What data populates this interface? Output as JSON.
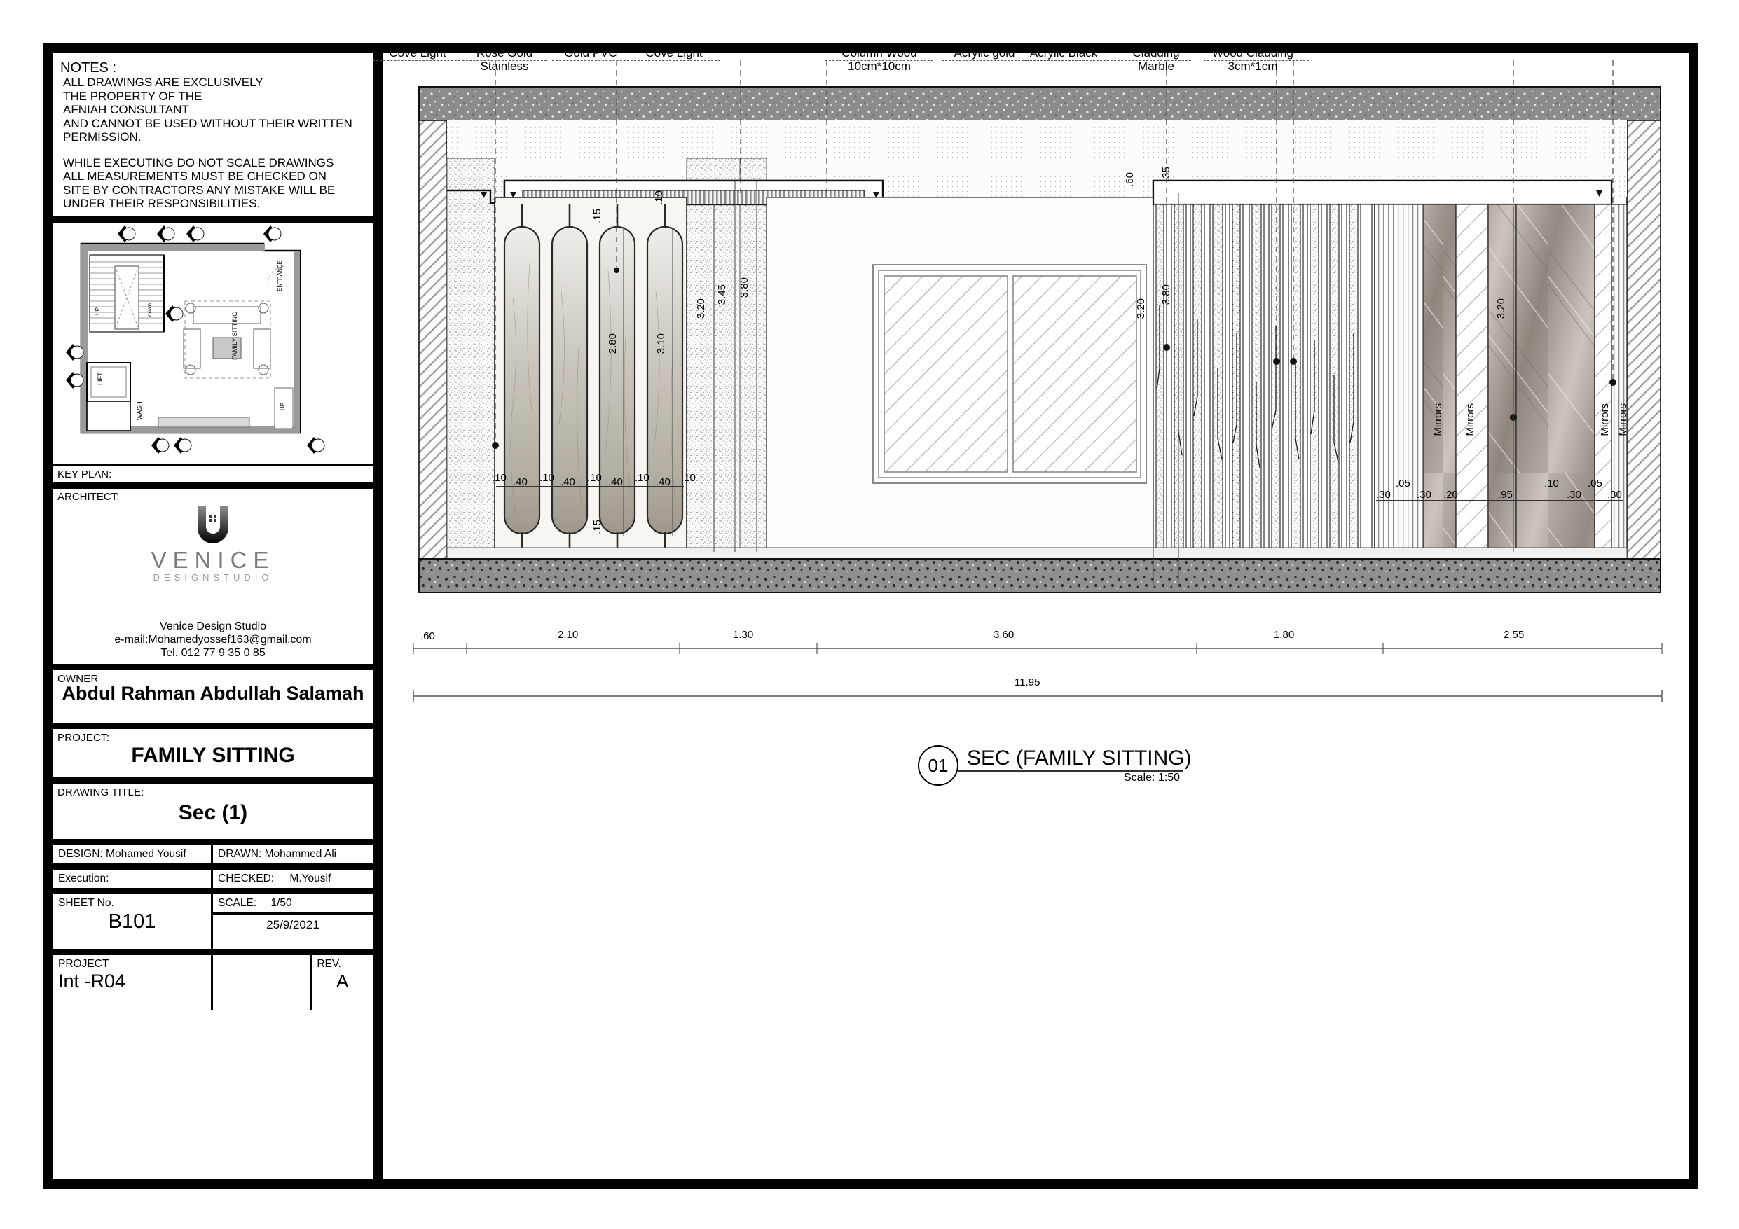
{
  "notes": {
    "heading": "NOTES :",
    "block1": "ALL DRAWINGS ARE EXCLUSIVELY\nTHE PROPERTY OF THE\nAFNIAH CONSULTANT\nAND CANNOT BE USED WITHOUT THEIR WRITTEN\nPERMISSION.",
    "block2": "WHILE EXECUTING DO NOT SCALE DRAWINGS\nALL MEASUREMENTS MUST BE CHECKED ON\nSITE BY CONTRACTORS ANY MISTAKE WILL BE\nUNDER THEIR RESPONSIBILITIES."
  },
  "keyplan": {
    "caption": "KEY  PLAN:",
    "room_labels": [
      "FAMILY SITTING",
      "LIFT",
      "WASH",
      "ENTRANCE",
      "UP",
      "down",
      "UP"
    ]
  },
  "architect": {
    "caption": "ARCHITECT:",
    "logo_word": "VENICE",
    "logo_sub": "DESIGNSTUDIO",
    "name": "Venice Design Studio",
    "email": "e-mail:Mohamedyossef163@gmail.com",
    "tel": "Tel. 012 77 9 35 0 85"
  },
  "titleblock": {
    "owner_label": "OWNER",
    "owner_value": "Abdul Rahman Abdullah Salamah",
    "project_label": "PROJECT:",
    "project_value": "FAMILY SITTING",
    "drawing_title_label": "DRAWING  TITLE:",
    "drawing_title_value": "Sec (1)",
    "design_label": "DESIGN:",
    "design_value": "Mohamed Yousif",
    "drawn_label": "DRAWN:",
    "drawn_value": "Mohammed Ali",
    "execution_label": "Execution:",
    "execution_value": "",
    "checked_label": "CHECKED:",
    "checked_value": "M.Yousif",
    "sheet_label": "SHEET  No.",
    "sheet_value": "B101",
    "scale_label": "SCALE:",
    "scale_value": "1/50",
    "date_value": "25/9/2021",
    "project_no_label": "PROJECT",
    "project_no_value": "Int -R04",
    "rev_label": "REV.",
    "rev_value": "A"
  },
  "annotations": [
    {
      "text1": "Cove Light",
      "text2": ""
    },
    {
      "text1": "Rose Gold",
      "text2": "Stainless"
    },
    {
      "text1": "Gold PVC",
      "text2": ""
    },
    {
      "text1": "Cove Light",
      "text2": ""
    },
    {
      "text1": "Column Wood",
      "text2": "10cm*10cm"
    },
    {
      "text1": "Acrylic gold",
      "text2": ""
    },
    {
      "text1": "Acrylic Black",
      "text2": ""
    },
    {
      "text1": "Cladding",
      "text2": "Marble"
    },
    {
      "text1": "Wood Cladding",
      "text2": "3cm*1cm"
    }
  ],
  "material_labels": [
    "Mirrors",
    "Mirrors",
    "Mirrors",
    "Mirrors"
  ],
  "dimensions": {
    "horizontal_chain": [
      ".60",
      "2.10",
      "1.30",
      "3.60",
      "1.80",
      "2.55"
    ],
    "overall": "11.95",
    "panel_chain": [
      ".10",
      ".40",
      ".10",
      ".40",
      ".10",
      ".40",
      ".10",
      ".40",
      ".10"
    ],
    "right_chain": [
      ".30",
      ".05",
      ".30",
      ".20",
      ".95",
      ".10",
      ".30",
      ".05",
      ".30"
    ],
    "vertical": [
      "3.20",
      "3.45",
      "3.80",
      "3.20",
      "3.20",
      "2.80",
      "3.10",
      ".15",
      ".15",
      ".10",
      ".60",
      ".35"
    ]
  },
  "section_tag": {
    "number": "01",
    "title": "SEC (FAMILY SITTING)",
    "scale": "Scale: 1:50"
  }
}
